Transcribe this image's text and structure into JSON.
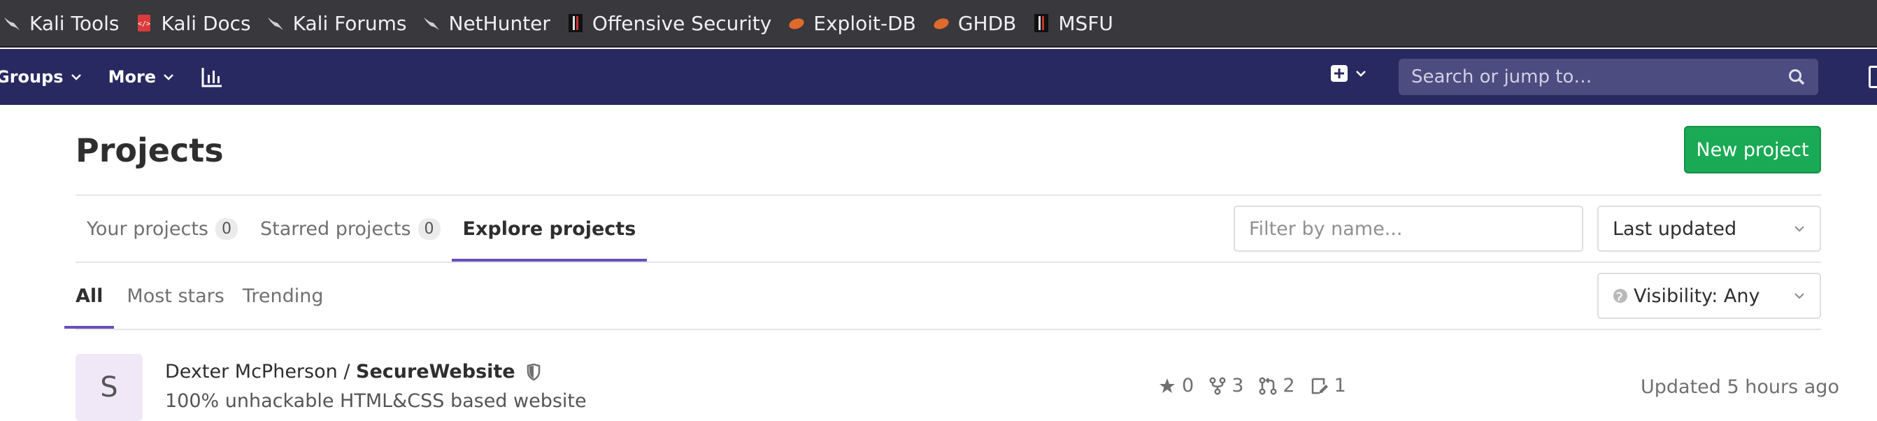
{
  "bookmarks": [
    {
      "label": "Kali Tools",
      "icon": "kali-dragon-icon"
    },
    {
      "label": "Kali Docs",
      "icon": "kali-docs-icon"
    },
    {
      "label": "Kali Forums",
      "icon": "kali-dragon-icon"
    },
    {
      "label": "NetHunter",
      "icon": "kali-dragon-icon"
    },
    {
      "label": "Offensive Security",
      "icon": "offsec-icon"
    },
    {
      "label": "Exploit-DB",
      "icon": "exploit-db-icon"
    },
    {
      "label": "GHDB",
      "icon": "exploit-db-icon"
    },
    {
      "label": "MSFU",
      "icon": "offsec-icon"
    }
  ],
  "navbar": {
    "groups_label": "Groups",
    "more_label": "More",
    "search_placeholder": "Search or jump to…"
  },
  "page": {
    "title": "Projects",
    "new_project_label": "New project"
  },
  "tabs": [
    {
      "label": "Your projects",
      "count": "0"
    },
    {
      "label": "Starred projects",
      "count": "0"
    },
    {
      "label": "Explore projects",
      "count": null
    }
  ],
  "filter": {
    "placeholder": "Filter by name...",
    "sort_label": "Last updated",
    "visibility_label": "Visibility: Any"
  },
  "subtabs": [
    "All",
    "Most stars",
    "Trending"
  ],
  "project": {
    "avatar_letter": "S",
    "owner": "Dexter McPherson / ",
    "name": "SecureWebsite",
    "description": "100% unhackable HTML&CSS based website",
    "stars": "0",
    "forks": "3",
    "merge_requests": "2",
    "issues": "1",
    "updated": "Updated 5 hours ago"
  },
  "colors": {
    "navbar": "#292961",
    "accent": "#6b4fbb",
    "new_project_button": "#1aaa55",
    "bookmarks_bar": "#38383d"
  }
}
